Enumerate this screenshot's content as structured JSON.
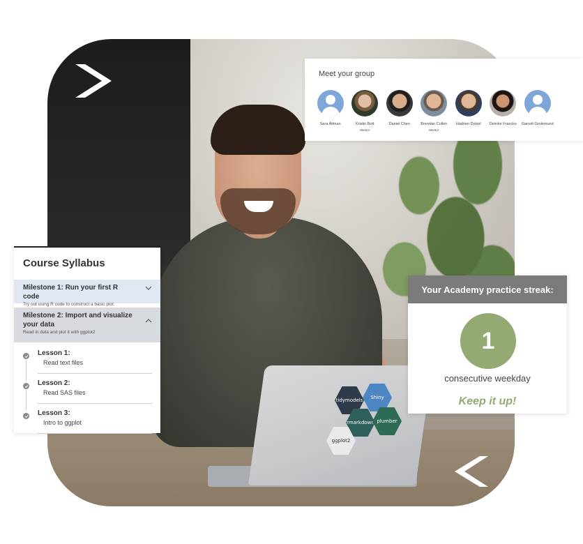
{
  "group": {
    "title": "Meet your group",
    "members": [
      {
        "name": "Sara Altman",
        "role": "",
        "avatar": "placeholder"
      },
      {
        "name": "Kristin Bott",
        "role": "Mentor",
        "avatar": "photo"
      },
      {
        "name": "Daniel Chen",
        "role": "",
        "avatar": "photo"
      },
      {
        "name": "Brendan Cullen",
        "role": "Mentor",
        "avatar": "photo"
      },
      {
        "name": "Hadrien Dykiel",
        "role": "",
        "avatar": "photo"
      },
      {
        "name": "Deirdre Francks",
        "role": "",
        "avatar": "photo"
      },
      {
        "name": "Garrett Grolemund",
        "role": "",
        "avatar": "placeholder"
      }
    ]
  },
  "syllabus": {
    "title": "Course Syllabus",
    "milestones": [
      {
        "title": "Milestone 1: Run your first R code",
        "subtitle": "Try out using R code to construct a basic plot.",
        "expanded": false
      },
      {
        "title": "Milestone 2: Import and visualize your data",
        "subtitle": "Read in data and plot it with ggplot2",
        "expanded": true
      }
    ],
    "lessons": [
      {
        "title": "Lesson 1:",
        "subtitle": "Read text files"
      },
      {
        "title": "Lesson 2:",
        "subtitle": "Read SAS files"
      },
      {
        "title": "Lesson 3:",
        "subtitle": "Intro to ggplot"
      }
    ]
  },
  "streak": {
    "header": "Your Academy practice streak:",
    "count": "1",
    "label": "consecutive weekday",
    "cheer": "Keep it up!"
  },
  "stickers": [
    "tidymodels",
    "Shiny",
    "rmarkdown",
    "plumber",
    "ggplot2"
  ],
  "colors": {
    "streak_green": "#93aa72",
    "milestone_blue": "#dfe7f3",
    "milestone_gray": "#d7dadf",
    "streak_header_gray": "#7b7b7b",
    "avatar_placeholder_blue": "#7fa6d9"
  }
}
